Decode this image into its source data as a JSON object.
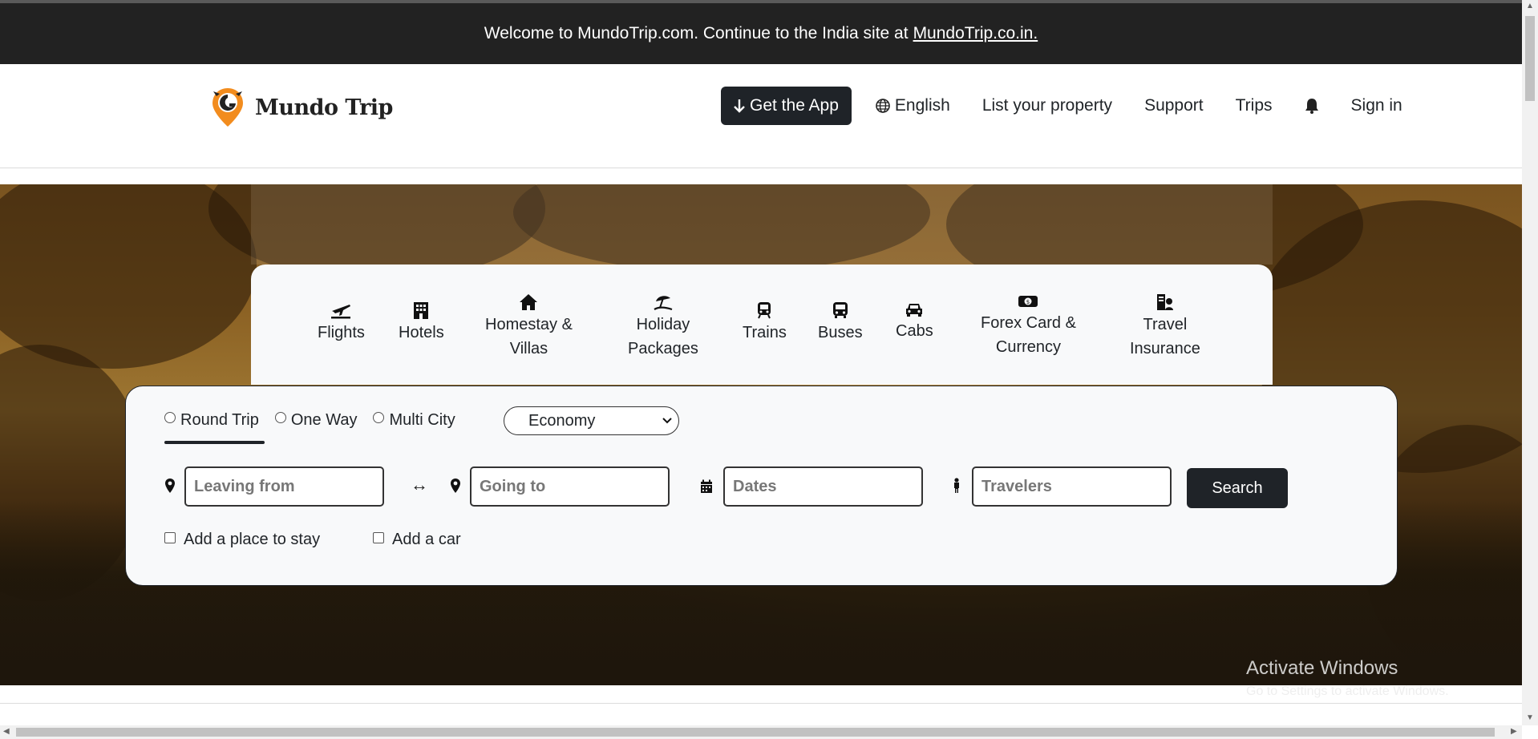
{
  "announcement": {
    "text": "Welcome to MundoTrip.com. Continue to the India site at",
    "link": "MundoTrip.co.in."
  },
  "header": {
    "brand": "Mundo Trip",
    "get_app": "Get the App",
    "language": "English",
    "list_property": "List your property",
    "support": "Support",
    "trips": "Trips",
    "sign_in": "Sign in"
  },
  "tabs": [
    {
      "line1": "Flights",
      "line2": "",
      "icon": "plane-icon"
    },
    {
      "line1": "Hotels",
      "line2": "",
      "icon": "hotel-icon"
    },
    {
      "line1": "Homestay &",
      "line2": "Villas",
      "icon": "home-icon"
    },
    {
      "line1": "Holiday",
      "line2": "Packages",
      "icon": "beach-umbrella-icon"
    },
    {
      "line1": "Trains",
      "line2": "",
      "icon": "train-icon"
    },
    {
      "line1": "Buses",
      "line2": "",
      "icon": "bus-icon"
    },
    {
      "line1": "Cabs",
      "line2": "",
      "icon": "car-icon"
    },
    {
      "line1": "Forex Card &",
      "line2": "Currency",
      "icon": "money-icon"
    },
    {
      "line1": "Travel",
      "line2": "Insurance",
      "icon": "insurance-icon"
    }
  ],
  "search": {
    "trip_types": [
      "Round Trip",
      "One Way",
      "Multi City"
    ],
    "selected_trip_type": "Round Trip",
    "cabin_class": "Economy",
    "leaving_placeholder": "Leaving from",
    "going_placeholder": "Going to",
    "dates_placeholder": "Dates",
    "travelers_placeholder": "Travelers",
    "search_label": "Search",
    "add_stay": "Add a place to stay",
    "add_car": "Add a car"
  },
  "watermark": {
    "title": "Activate Windows",
    "subtitle": "Go to Settings to activate Windows."
  },
  "colors": {
    "dark": "#1f2328",
    "banner": "#222222",
    "brand_orange": "#f28c1e",
    "panel": "#f8f9fa"
  }
}
